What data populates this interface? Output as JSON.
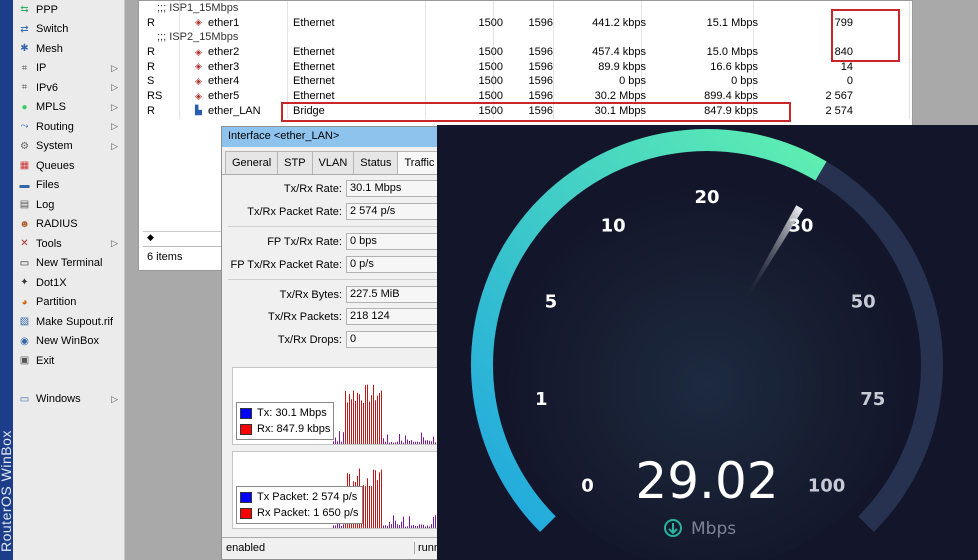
{
  "brand": {
    "text": "RouterOS WinBox"
  },
  "menu": {
    "items": [
      {
        "label": "PPP",
        "icon": "ppp-icon",
        "arrow": false
      },
      {
        "label": "Switch",
        "icon": "switch-icon",
        "arrow": false
      },
      {
        "label": "Mesh",
        "icon": "mesh-icon",
        "arrow": false
      },
      {
        "label": "IP",
        "icon": "ip-icon",
        "arrow": true
      },
      {
        "label": "IPv6",
        "icon": "ipv6-icon",
        "arrow": true
      },
      {
        "label": "MPLS",
        "icon": "mpls-icon",
        "arrow": true
      },
      {
        "label": "Routing",
        "icon": "routing-icon",
        "arrow": true
      },
      {
        "label": "System",
        "icon": "gear-icon",
        "arrow": true
      },
      {
        "label": "Queues",
        "icon": "queues-icon",
        "arrow": false
      },
      {
        "label": "Files",
        "icon": "folder-icon",
        "arrow": false
      },
      {
        "label": "Log",
        "icon": "log-icon",
        "arrow": false
      },
      {
        "label": "RADIUS",
        "icon": "radius-icon",
        "arrow": false
      },
      {
        "label": "Tools",
        "icon": "tools-icon",
        "arrow": true
      },
      {
        "label": "New Terminal",
        "icon": "terminal-icon",
        "arrow": false
      },
      {
        "label": "Dot1X",
        "icon": "dot1x-icon",
        "arrow": false
      },
      {
        "label": "Partition",
        "icon": "partition-icon",
        "arrow": false
      },
      {
        "label": "Make Supout.rif",
        "icon": "supout-icon",
        "arrow": false
      },
      {
        "label": "New WinBox",
        "icon": "winbox-icon",
        "arrow": false
      },
      {
        "label": "Exit",
        "icon": "exit-icon",
        "arrow": false
      }
    ],
    "windows": {
      "label": "Windows",
      "icon": "windows-icon"
    }
  },
  "interfaces": {
    "rows": [
      {
        "kind": "comment",
        "text": ";;; ISP1_15Mbps"
      },
      {
        "kind": "row",
        "flag": "R",
        "name": "ether1",
        "type": "Ethernet",
        "mtu": "1500",
        "l2mtu": "1596",
        "tx": "441.2 kbps",
        "rx": "15.1 Mbps",
        "pkts": "799",
        "icon": "ethernet-port-icon"
      },
      {
        "kind": "comment",
        "text": ";;; ISP2_15Mbps"
      },
      {
        "kind": "row",
        "flag": "R",
        "name": "ether2",
        "type": "Ethernet",
        "mtu": "1500",
        "l2mtu": "1596",
        "tx": "457.4 kbps",
        "rx": "15.0 Mbps",
        "pkts": "840",
        "icon": "ethernet-port-icon"
      },
      {
        "kind": "row",
        "flag": "R",
        "name": "ether3",
        "type": "Ethernet",
        "mtu": "1500",
        "l2mtu": "1596",
        "tx": "89.9 kbps",
        "rx": "16.6 kbps",
        "pkts": "14",
        "icon": "ethernet-port-icon"
      },
      {
        "kind": "row",
        "flag": "S",
        "name": "ether4",
        "type": "Ethernet",
        "mtu": "1500",
        "l2mtu": "1596",
        "tx": "0 bps",
        "rx": "0 bps",
        "pkts": "0",
        "icon": "ethernet-port-icon"
      },
      {
        "kind": "row",
        "flag": "RS",
        "name": "ether5",
        "type": "Ethernet",
        "mtu": "1500",
        "l2mtu": "1596",
        "tx": "30.2 Mbps",
        "rx": "899.4 kbps",
        "pkts": "2 567",
        "icon": "ethernet-port-icon"
      },
      {
        "kind": "row",
        "flag": "R",
        "name": "ether_LAN",
        "type": "Bridge",
        "mtu": "1500",
        "l2mtu": "1596",
        "tx": "30.1 Mbps",
        "rx": "847.9 kbps",
        "pkts": "2 574",
        "icon": "bridge-icon"
      }
    ],
    "scroll_marker": "◆",
    "status": "6 items"
  },
  "dialog": {
    "title": "Interface <ether_LAN>",
    "tabs": [
      "General",
      "STP",
      "VLAN",
      "Status",
      "Traffic"
    ],
    "active_tab": "Traffic",
    "fields": {
      "txrx_rate": {
        "label": "Tx/Rx Rate:",
        "value": "30.1 Mbps"
      },
      "txrx_packet_rate": {
        "label": "Tx/Rx Packet Rate:",
        "value": "2 574 p/s"
      },
      "fp_txrx_rate": {
        "label": "FP Tx/Rx Rate:",
        "value": "0 bps"
      },
      "fp_txrx_packet_rate": {
        "label": "FP Tx/Rx Packet Rate:",
        "value": "0 p/s"
      },
      "txrx_bytes": {
        "label": "Tx/Rx Bytes:",
        "value": "227.5 MiB"
      },
      "txrx_packets": {
        "label": "Tx/Rx Packets:",
        "value": "218 124"
      },
      "txrx_drops": {
        "label": "Tx/Rx Drops:",
        "value": "0"
      }
    },
    "graph1": {
      "tx_label": "Tx:  30.1 Mbps",
      "rx_label": "Rx:  847.9 kbps"
    },
    "graph2": {
      "tx_label": "Tx Packet:  2 574 p/s",
      "rx_label": "Rx Packet:  1 650 p/s"
    },
    "status_left": "enabled",
    "status_right": "runn"
  },
  "speedtest": {
    "value": "29.02",
    "unit": "Mbps",
    "reading": 29.02,
    "ticks": [
      "0",
      "1",
      "5",
      "10",
      "20",
      "30",
      "50",
      "75",
      "100"
    ],
    "colors": {
      "bg": "#13162a",
      "arc_start": "#1fa6e0",
      "arc_end": "#5ff0b0",
      "track": "#26324f",
      "needle": "#ffffff"
    }
  },
  "colors": {
    "highlight": "#c9262c",
    "tx": "#0000ff",
    "rx": "#ff0000"
  }
}
